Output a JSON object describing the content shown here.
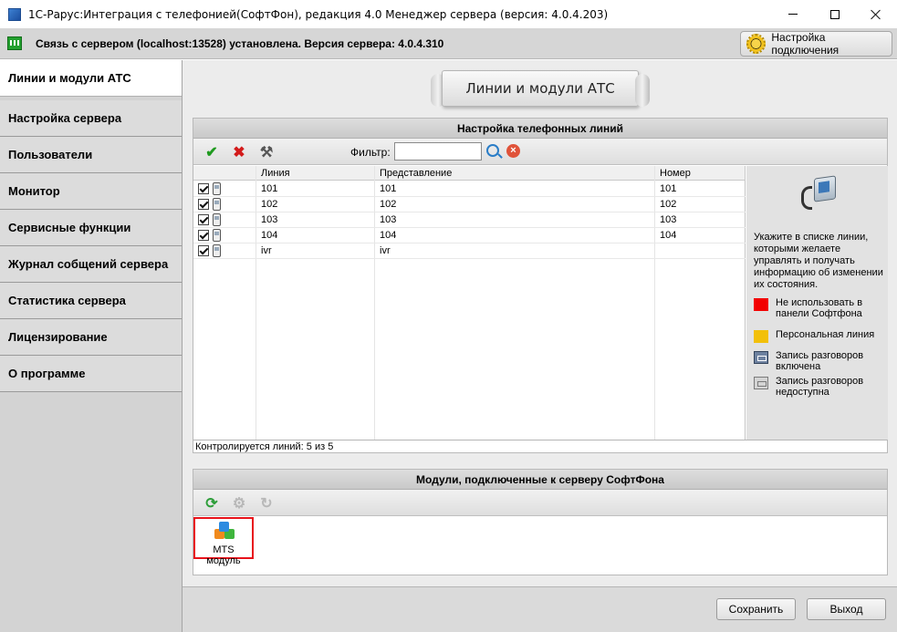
{
  "window": {
    "title": "1С-Рарус:Интеграция с телефонией(СофтФон), редакция 4.0 Менеджер сервера (версия: 4.0.4.203)"
  },
  "status": {
    "connection_text": "Связь с сервером (localhost:13528) установлена. Версия сервера: 4.0.4.310",
    "connect_settings_label": "Настройка подключения"
  },
  "sidebar": {
    "items": [
      {
        "label": "Линии и модули АТС",
        "active": true
      },
      {
        "label": "Настройка сервера"
      },
      {
        "label": "Пользователи"
      },
      {
        "label": "Монитор"
      },
      {
        "label": "Сервисные функции"
      },
      {
        "label": "Журнал собщений сервера"
      },
      {
        "label": "Статистика сервера"
      },
      {
        "label": "Лицензирование"
      },
      {
        "label": "О программе"
      }
    ]
  },
  "main": {
    "banner_title": "Линии и модули АТС",
    "lines_panel": {
      "title": "Настройка телефонных линий",
      "filter_label": "Фильтр:",
      "filter_value": "",
      "columns": [
        "Линия",
        "Представление",
        "Номер"
      ],
      "rows": [
        {
          "line": "101",
          "view": "101",
          "number": "101",
          "checked": true
        },
        {
          "line": "102",
          "view": "102",
          "number": "102",
          "checked": true
        },
        {
          "line": "103",
          "view": "103",
          "number": "103",
          "checked": true
        },
        {
          "line": "104",
          "view": "104",
          "number": "104",
          "checked": true
        },
        {
          "line": "ivr",
          "view": "ivr",
          "number": "",
          "checked": true
        }
      ],
      "info_text": "Укажите в списке линии, которыми желаете управлять и получать информацию об изменении их состояния.",
      "legend": [
        {
          "label": "Не использовать в панели Софтфона",
          "color": "#f20000"
        },
        {
          "label": "Персональная линия",
          "color": "#f2c00a"
        },
        {
          "label": "Запись разговоров включена",
          "icon": "recording-on-icon"
        },
        {
          "label": "Запись разговоров недоступна",
          "icon": "recording-off-icon"
        }
      ],
      "footer": "Контролируется линий: 5 из 5"
    },
    "modules_panel": {
      "title": "Модули, подключенные к серверу СофтФона",
      "modules": [
        {
          "label": "MTS модуль",
          "icon": "cubes-icon"
        }
      ]
    }
  },
  "buttons": {
    "save": "Сохранить",
    "exit": "Выход"
  }
}
